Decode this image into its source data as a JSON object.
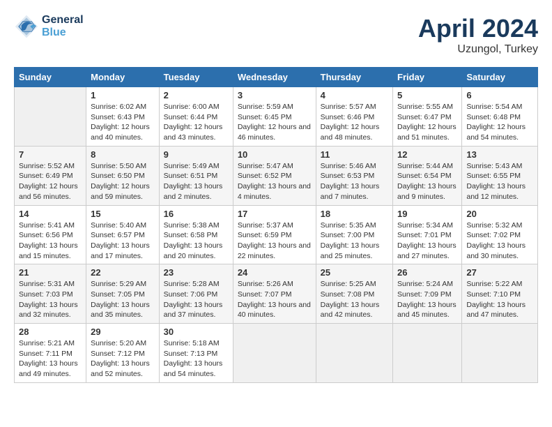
{
  "header": {
    "logo_line1": "General",
    "logo_line2": "Blue",
    "title": "April 2024",
    "subtitle": "Uzungol, Turkey"
  },
  "days_of_week": [
    "Sunday",
    "Monday",
    "Tuesday",
    "Wednesday",
    "Thursday",
    "Friday",
    "Saturday"
  ],
  "weeks": [
    [
      {
        "day": "",
        "empty": true
      },
      {
        "day": "1",
        "sunrise": "6:02 AM",
        "sunset": "6:43 PM",
        "daylight": "12 hours and 40 minutes."
      },
      {
        "day": "2",
        "sunrise": "6:00 AM",
        "sunset": "6:44 PM",
        "daylight": "12 hours and 43 minutes."
      },
      {
        "day": "3",
        "sunrise": "5:59 AM",
        "sunset": "6:45 PM",
        "daylight": "12 hours and 46 minutes."
      },
      {
        "day": "4",
        "sunrise": "5:57 AM",
        "sunset": "6:46 PM",
        "daylight": "12 hours and 48 minutes."
      },
      {
        "day": "5",
        "sunrise": "5:55 AM",
        "sunset": "6:47 PM",
        "daylight": "12 hours and 51 minutes."
      },
      {
        "day": "6",
        "sunrise": "5:54 AM",
        "sunset": "6:48 PM",
        "daylight": "12 hours and 54 minutes."
      }
    ],
    [
      {
        "day": "7",
        "sunrise": "5:52 AM",
        "sunset": "6:49 PM",
        "daylight": "12 hours and 56 minutes."
      },
      {
        "day": "8",
        "sunrise": "5:50 AM",
        "sunset": "6:50 PM",
        "daylight": "12 hours and 59 minutes."
      },
      {
        "day": "9",
        "sunrise": "5:49 AM",
        "sunset": "6:51 PM",
        "daylight": "13 hours and 2 minutes."
      },
      {
        "day": "10",
        "sunrise": "5:47 AM",
        "sunset": "6:52 PM",
        "daylight": "13 hours and 4 minutes."
      },
      {
        "day": "11",
        "sunrise": "5:46 AM",
        "sunset": "6:53 PM",
        "daylight": "13 hours and 7 minutes."
      },
      {
        "day": "12",
        "sunrise": "5:44 AM",
        "sunset": "6:54 PM",
        "daylight": "13 hours and 9 minutes."
      },
      {
        "day": "13",
        "sunrise": "5:43 AM",
        "sunset": "6:55 PM",
        "daylight": "13 hours and 12 minutes."
      }
    ],
    [
      {
        "day": "14",
        "sunrise": "5:41 AM",
        "sunset": "6:56 PM",
        "daylight": "13 hours and 15 minutes."
      },
      {
        "day": "15",
        "sunrise": "5:40 AM",
        "sunset": "6:57 PM",
        "daylight": "13 hours and 17 minutes."
      },
      {
        "day": "16",
        "sunrise": "5:38 AM",
        "sunset": "6:58 PM",
        "daylight": "13 hours and 20 minutes."
      },
      {
        "day": "17",
        "sunrise": "5:37 AM",
        "sunset": "6:59 PM",
        "daylight": "13 hours and 22 minutes."
      },
      {
        "day": "18",
        "sunrise": "5:35 AM",
        "sunset": "7:00 PM",
        "daylight": "13 hours and 25 minutes."
      },
      {
        "day": "19",
        "sunrise": "5:34 AM",
        "sunset": "7:01 PM",
        "daylight": "13 hours and 27 minutes."
      },
      {
        "day": "20",
        "sunrise": "5:32 AM",
        "sunset": "7:02 PM",
        "daylight": "13 hours and 30 minutes."
      }
    ],
    [
      {
        "day": "21",
        "sunrise": "5:31 AM",
        "sunset": "7:03 PM",
        "daylight": "13 hours and 32 minutes."
      },
      {
        "day": "22",
        "sunrise": "5:29 AM",
        "sunset": "7:05 PM",
        "daylight": "13 hours and 35 minutes."
      },
      {
        "day": "23",
        "sunrise": "5:28 AM",
        "sunset": "7:06 PM",
        "daylight": "13 hours and 37 minutes."
      },
      {
        "day": "24",
        "sunrise": "5:26 AM",
        "sunset": "7:07 PM",
        "daylight": "13 hours and 40 minutes."
      },
      {
        "day": "25",
        "sunrise": "5:25 AM",
        "sunset": "7:08 PM",
        "daylight": "13 hours and 42 minutes."
      },
      {
        "day": "26",
        "sunrise": "5:24 AM",
        "sunset": "7:09 PM",
        "daylight": "13 hours and 45 minutes."
      },
      {
        "day": "27",
        "sunrise": "5:22 AM",
        "sunset": "7:10 PM",
        "daylight": "13 hours and 47 minutes."
      }
    ],
    [
      {
        "day": "28",
        "sunrise": "5:21 AM",
        "sunset": "7:11 PM",
        "daylight": "13 hours and 49 minutes."
      },
      {
        "day": "29",
        "sunrise": "5:20 AM",
        "sunset": "7:12 PM",
        "daylight": "13 hours and 52 minutes."
      },
      {
        "day": "30",
        "sunrise": "5:18 AM",
        "sunset": "7:13 PM",
        "daylight": "13 hours and 54 minutes."
      },
      {
        "day": "",
        "empty": true
      },
      {
        "day": "",
        "empty": true
      },
      {
        "day": "",
        "empty": true
      },
      {
        "day": "",
        "empty": true
      }
    ]
  ],
  "labels": {
    "sunrise_prefix": "Sunrise: ",
    "sunset_prefix": "Sunset: ",
    "daylight_prefix": "Daylight: "
  }
}
